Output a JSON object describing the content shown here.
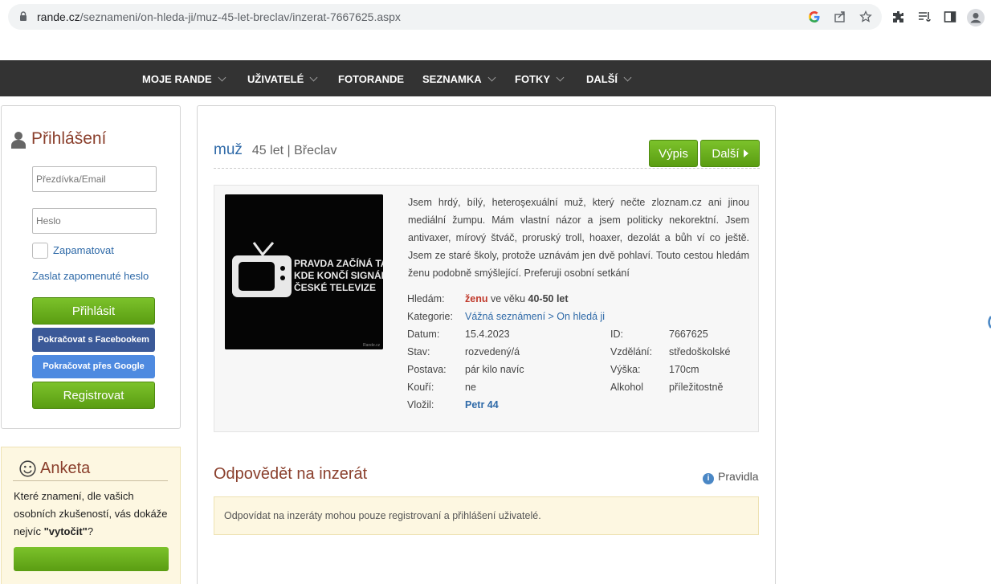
{
  "browser": {
    "url_host": "rande.cz",
    "url_path": "/seznameni/on-hleda-ji/muz-45-let-breclav/inzerat-7667625.aspx"
  },
  "nav": {
    "items": [
      {
        "label": "MOJE RANDE",
        "dropdown": true
      },
      {
        "label": "UŽIVATELÉ",
        "dropdown": true
      },
      {
        "label": "FOTORANDE",
        "dropdown": false
      },
      {
        "label": "SEZNAMKA",
        "dropdown": true
      },
      {
        "label": "FOTKY",
        "dropdown": true
      },
      {
        "label": "DALŠÍ",
        "dropdown": true
      }
    ]
  },
  "login": {
    "title": "Přihlášení",
    "nick_placeholder": "Přezdívka/Email",
    "password_placeholder": "Heslo",
    "remember_label": "Zapamatovat",
    "forgot_label": "Zaslat zapomenuté heslo",
    "login_button": "Přihlásit",
    "facebook_button": "Pokračovat s Facebookem",
    "google_button": "Pokračovat přes Google",
    "register_button": "Registrovat"
  },
  "poll": {
    "title": "Anketa",
    "question_pre": "Které znamení, dle vašich osobních zkušeností, vás dokáže nejvíc ",
    "question_bold": "\"vytočit\"",
    "question_post": "?"
  },
  "ad": {
    "gender": "muž",
    "meta": "45 let | Břeclav",
    "list_button": "Výpis",
    "next_button": "Další",
    "photo_text": [
      "PRAVDA ZAČÍNÁ TAM,",
      "KDE KONČÍ SIGNÁL",
      "ČESKÉ TELEVIZE"
    ],
    "photo_watermark": "Rande.cz",
    "description": "Jsem hrdý, bílý, heteroşexuální muž, který nečte zloznam.cz ani jinou mediální žumpu. Mám vlastní názor a jsem politicky nekorektní. Jsem antivaxer, mírový štváč, proruský troll, hoaxer, dezolát a bůh ví co ještě. Jsem ze staré školy, protože uznávám jen dvě pohlaví. Touto cestou hledám ženu podobně smýšlející. Preferuji osobní setkání",
    "seeking_label": "Hledám:",
    "seeking_target": "ženu",
    "seeking_mid": " ve věku ",
    "seeking_age": "40-50 let",
    "category_label": "Kategorie:",
    "category_value": "Vážná seznámení > On hledá ji",
    "date_label": "Datum:",
    "date_value": "15.4.2023",
    "id_label": "ID:",
    "id_value": "7667625",
    "status_label": "Stav:",
    "status_value": "rozvedený/á",
    "education_label": "Vzdělání:",
    "education_value": "středoškolské",
    "build_label": "Postava:",
    "build_value": "pár kilo navíc",
    "height_label": "Výška:",
    "height_value": "170cm",
    "smoke_label": "Kouří:",
    "smoke_value": "ne",
    "alcohol_label": "Alkohol",
    "alcohol_value": "příležitostně",
    "author_label": "Vložil:",
    "author_value": "Petr 44"
  },
  "reply": {
    "title": "Odpovědět na inzerát",
    "rules_label": "Pravidla",
    "notice": "Odpovídat na inzeráty mohou pouze registrovaní a přihlášení uživatelé."
  },
  "colors": {
    "accent_title": "#8a3f2c",
    "link": "#2f6aa8",
    "nav_bg": "#333333",
    "button_green": "#6bb01f"
  }
}
